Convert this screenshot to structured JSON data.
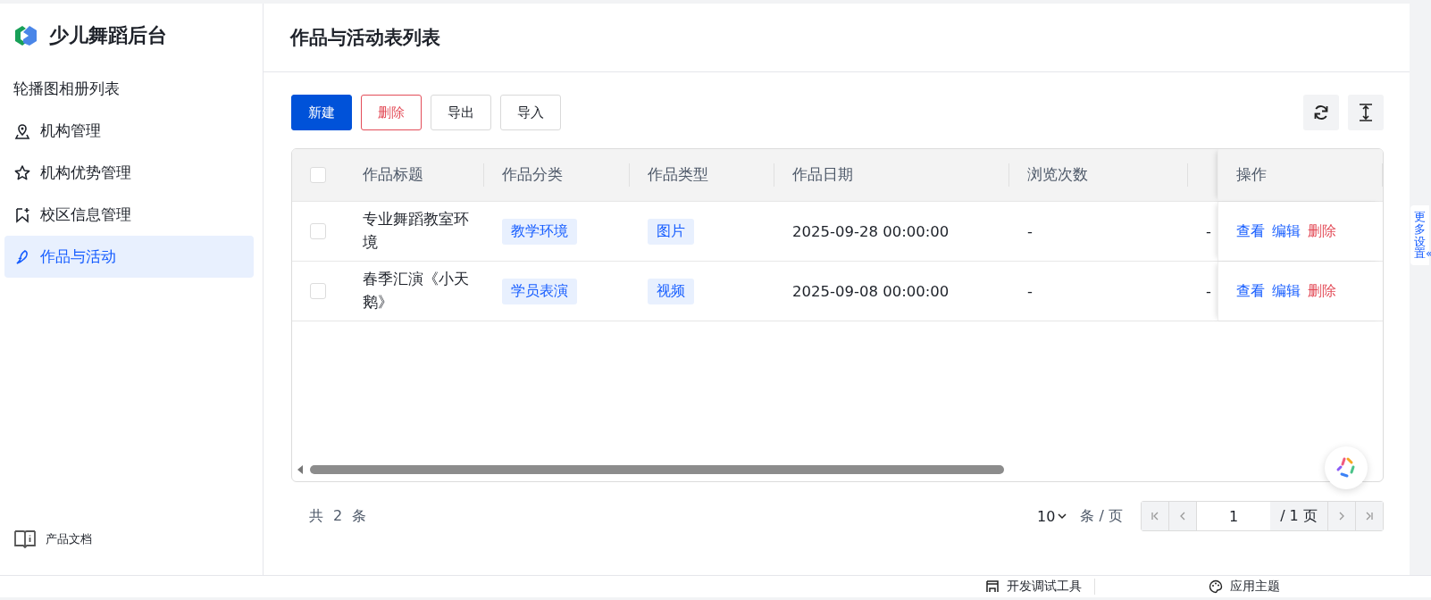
{
  "app": {
    "name": "少儿舞蹈后台"
  },
  "sidebar": {
    "items": [
      {
        "label": "轮播图相册列表",
        "selected": false
      },
      {
        "label": "机构管理",
        "selected": false
      },
      {
        "label": "机构优势管理",
        "selected": false
      },
      {
        "label": "校区信息管理",
        "selected": false
      },
      {
        "label": "作品与活动",
        "selected": true
      }
    ],
    "footer": "产品文档"
  },
  "page": {
    "title": "作品与活动表列表"
  },
  "toolbar": {
    "buttons": [
      {
        "label": "新建",
        "kind": "primary"
      },
      {
        "label": "删除",
        "kind": "danger"
      },
      {
        "label": "导出",
        "kind": "default"
      },
      {
        "label": "导入",
        "kind": "default"
      }
    ]
  },
  "table": {
    "select_all_checked": false,
    "columns": [
      "作品标题",
      "作品分类",
      "作品类型",
      "作品日期",
      "浏览次数"
    ],
    "action_column": "操作",
    "rows": [
      {
        "checked": false,
        "title": "专业舞蹈教室环境",
        "category": "教学环境",
        "type": "图片",
        "date": "2025-09-28 00:00:00",
        "views": "-",
        "column_7": "-",
        "actions": [
          {
            "label": "查看",
            "kind": "link"
          },
          {
            "label": "编辑",
            "kind": "link"
          },
          {
            "label": "删除",
            "kind": "danger"
          }
        ]
      },
      {
        "checked": false,
        "title": "春季汇演《小天鹅》",
        "category": "学员表演",
        "type": "视频",
        "date": "2025-09-08 00:00:00",
        "views": "-",
        "column_7": "-",
        "actions": [
          {
            "label": "查看",
            "kind": "link"
          },
          {
            "label": "编辑",
            "kind": "link"
          },
          {
            "label": "删除",
            "kind": "danger"
          }
        ]
      }
    ]
  },
  "pagination": {
    "total": "共 2 条",
    "page_size": "10",
    "unit": "条 / 页",
    "page": "1",
    "pages": "/ 1 页"
  },
  "side_tab": "更多设置«",
  "bottom_bar": {
    "items": [
      "开发调试工具",
      "应用主题"
    ]
  }
}
